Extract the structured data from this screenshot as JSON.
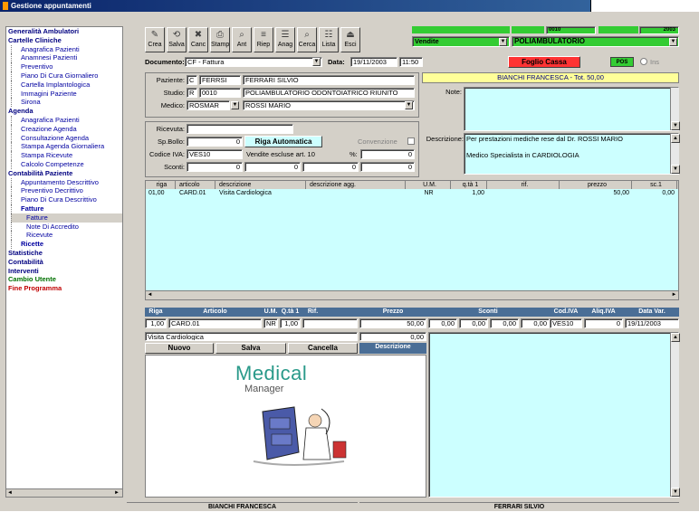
{
  "window": {
    "title": "Gestione appuntamenti"
  },
  "nav": {
    "items": [
      {
        "label": "Generalità Ambulatori",
        "level": "h"
      },
      {
        "label": "Cartelle Cliniche",
        "level": "h"
      },
      {
        "label": "Anagrafica Pazienti",
        "level": "i"
      },
      {
        "label": "Anamnesi Pazienti",
        "level": "i"
      },
      {
        "label": "Preventivo",
        "level": "i"
      },
      {
        "label": "Piano Di Cura Giornaliero",
        "level": "i"
      },
      {
        "label": "Cartella Implantologica",
        "level": "i"
      },
      {
        "label": "Immagini Paziente",
        "level": "i"
      },
      {
        "label": "Sirona",
        "level": "i"
      },
      {
        "label": "Agenda",
        "level": "h"
      },
      {
        "label": "Anagrafica Pazienti",
        "level": "i"
      },
      {
        "label": "Creazione Agenda",
        "level": "i"
      },
      {
        "label": "Consultazione Agenda",
        "level": "i"
      },
      {
        "label": "Stampa Agenda Giornaliera",
        "level": "i"
      },
      {
        "label": "Stampa Ricevute",
        "level": "i"
      },
      {
        "label": "Calcolo Competenze",
        "level": "i"
      },
      {
        "label": "Contabilità Paziente",
        "level": "h"
      },
      {
        "label": "Appuntamento Descrittivo",
        "level": "i"
      },
      {
        "label": "Preventivo Decrittivo",
        "level": "i"
      },
      {
        "label": "Piano Di Cura Descrittivo",
        "level": "i"
      },
      {
        "label": "Fatture",
        "level": "ih"
      },
      {
        "label": "Fatture",
        "level": "ii",
        "selected": true
      },
      {
        "label": "Note Di Accredito",
        "level": "ii"
      },
      {
        "label": "Ricevute",
        "level": "ii"
      },
      {
        "label": "Ricette",
        "level": "ih"
      },
      {
        "label": "Statistiche",
        "level": "h"
      },
      {
        "label": "Contabilità",
        "level": "h"
      },
      {
        "label": "Interventi",
        "level": "h"
      },
      {
        "label": "Cambio Utente",
        "level": "g"
      },
      {
        "label": "Fine Programma",
        "level": "r"
      }
    ]
  },
  "toolbar": {
    "buttons": [
      "Crea",
      "Salva",
      "Canc",
      "Stamp",
      "Ant",
      "Riep",
      "Anag",
      "Cerca",
      "Lista",
      "Esci"
    ],
    "icons": [
      "create-icon",
      "save-icon",
      "delete-icon",
      "print-icon",
      "preview-icon",
      "summary-icon",
      "registry-icon",
      "search-icon",
      "list-icon",
      "exit-icon"
    ]
  },
  "top_selects": {
    "vendite": "Vendite",
    "reparto_code": "0010",
    "reparto": "POLIAMBULATORIO",
    "year": "2003"
  },
  "document": {
    "label": "Documento:",
    "value": "CF - Fattura",
    "data_label": "Data:",
    "date": "19/11/2003",
    "time": "11:50",
    "foglio_cassa": "Foglio Cassa",
    "pos": "POS",
    "ins": "Ins"
  },
  "paziente": {
    "label": "Paziente:",
    "code": "C",
    "surname": "FERRSI",
    "name": "FERRARI SILVIO"
  },
  "studio": {
    "label": "Studio:",
    "code": "R",
    "num": "0010",
    "name": "POLIAMBULATORIO ODONTOIATRICO RIUNITO"
  },
  "medico": {
    "label": "Medico:",
    "code": "ROSMAR",
    "name": "ROSSI MARIO"
  },
  "banner": "BIANCHI FRANCESCA - Tot. 50,00",
  "note_label": "Note:",
  "descrizione_label": "Descrizione:",
  "descrizione_text": [
    "Per prestazioni mediche rese dal Dr. ROSSI MARIO",
    "",
    "Medico Specialista in CARDIOLOGIA"
  ],
  "ricevuta": {
    "label": "Ricevuta:",
    "value": ""
  },
  "bollo": {
    "label": "Sp.Bollo:",
    "value": "0",
    "riga_auto": "Riga Automatica",
    "convenzione": "Convenzione"
  },
  "iva": {
    "label": "Codice IVA:",
    "code": "VES10",
    "desc": "Vendite escluse art. 10",
    "pct_label": "%:",
    "pct": "0"
  },
  "sconti": {
    "label": "Sconti:",
    "v1": "0",
    "v2": "0",
    "v3": "0",
    "v4": "0"
  },
  "grid": {
    "headers": [
      "riga",
      "articolo",
      "descrizione",
      "descrizione agg.",
      "U.M.",
      "q.tà 1",
      "rif.",
      "prezzo",
      "sc.1"
    ],
    "rows": [
      [
        "01,00",
        "CARD.01",
        "Visita Cardiologica",
        "",
        "NR",
        "1,00",
        "",
        "50,00",
        "0,00"
      ]
    ]
  },
  "detail": {
    "headers": [
      "Riga",
      "Articolo",
      "U.M.",
      "Q.tà 1",
      "Rif.",
      "Prezzo",
      "Sconti",
      "Cod.IVA",
      "Aliq.IVA",
      "Data Var."
    ],
    "riga": "1,00",
    "articolo": "CARD.01",
    "um": "NR",
    "qta": "1,00",
    "rif": "",
    "prezzo": "50,00",
    "sc1": "0,00",
    "sc2": "0,00",
    "sc3": "0,00",
    "sc4": "0,00",
    "codiva": "VES10",
    "aliq": "0",
    "datavar": "19/11/2003",
    "descrizione": "Visita Cardiologica",
    "zero": "0,00"
  },
  "actions": {
    "nuovo": "Nuovo",
    "salva": "Salva",
    "cancella": "Cancella",
    "descrizione": "Descrizione"
  },
  "logo": {
    "line1": "Medical",
    "line2": "Manager"
  },
  "status": {
    "left": "BIANCHI FRANCESCA",
    "right": "FERRARI SILVIO"
  },
  "colors": {
    "green": "#33cc33",
    "cyan": "#ccffff",
    "navy": "#0a246a",
    "header": "#4a6e96"
  }
}
